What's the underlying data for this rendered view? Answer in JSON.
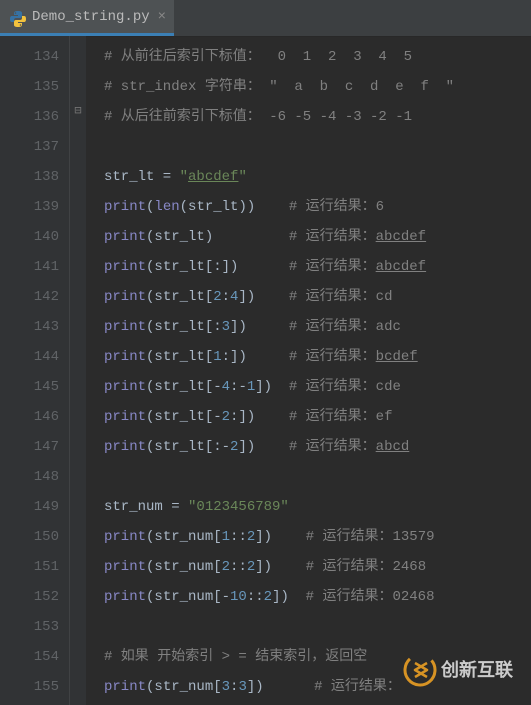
{
  "tab": {
    "filename": "Demo_string.py"
  },
  "lines": [
    {
      "n": "134",
      "fold": "",
      "t": [
        {
          "c": "tok-com",
          "x": "# 从前往后索引下标值：  0  1  2  3  4  5"
        }
      ]
    },
    {
      "n": "135",
      "fold": "",
      "t": [
        {
          "c": "tok-com",
          "x": "# str_index 字符串： ″  a  b  c  d  e  f  ″"
        }
      ]
    },
    {
      "n": "136",
      "fold": "⊟",
      "t": [
        {
          "c": "tok-com",
          "x": "# 从后往前索引下标值： -6 -5 -4 -3 -2 -1"
        }
      ]
    },
    {
      "n": "137",
      "fold": "",
      "t": []
    },
    {
      "n": "138",
      "fold": "",
      "t": [
        {
          "c": "tok-id",
          "x": "str_lt = "
        },
        {
          "c": "tok-str",
          "x": "″"
        },
        {
          "c": "tok-str ul",
          "x": "abcdef"
        },
        {
          "c": "tok-str",
          "x": "″"
        }
      ]
    },
    {
      "n": "139",
      "fold": "",
      "t": [
        {
          "c": "tok-bi",
          "x": "print"
        },
        {
          "c": "tok-id",
          "x": "("
        },
        {
          "c": "tok-bi",
          "x": "len"
        },
        {
          "c": "tok-id",
          "x": "(str_lt))    "
        },
        {
          "c": "tok-com",
          "x": "# 运行结果：6"
        }
      ]
    },
    {
      "n": "140",
      "fold": "",
      "t": [
        {
          "c": "tok-bi",
          "x": "print"
        },
        {
          "c": "tok-id",
          "x": "(str_lt)         "
        },
        {
          "c": "tok-com",
          "x": "# 运行结果："
        },
        {
          "c": "tok-com ul",
          "x": "abcdef"
        }
      ]
    },
    {
      "n": "141",
      "fold": "",
      "t": [
        {
          "c": "tok-bi",
          "x": "print"
        },
        {
          "c": "tok-id",
          "x": "(str_lt[:])      "
        },
        {
          "c": "tok-com",
          "x": "# 运行结果："
        },
        {
          "c": "tok-com ul",
          "x": "abcdef"
        }
      ]
    },
    {
      "n": "142",
      "fold": "",
      "t": [
        {
          "c": "tok-bi",
          "x": "print"
        },
        {
          "c": "tok-id",
          "x": "(str_lt["
        },
        {
          "c": "tok-num",
          "x": "2"
        },
        {
          "c": "tok-id",
          "x": ":"
        },
        {
          "c": "tok-num",
          "x": "4"
        },
        {
          "c": "tok-id",
          "x": "])    "
        },
        {
          "c": "tok-com",
          "x": "# 运行结果：cd"
        }
      ]
    },
    {
      "n": "143",
      "fold": "",
      "t": [
        {
          "c": "tok-bi",
          "x": "print"
        },
        {
          "c": "tok-id",
          "x": "(str_lt[:"
        },
        {
          "c": "tok-num",
          "x": "3"
        },
        {
          "c": "tok-id",
          "x": "])     "
        },
        {
          "c": "tok-com",
          "x": "# 运行结果：adc"
        }
      ]
    },
    {
      "n": "144",
      "fold": "",
      "t": [
        {
          "c": "tok-bi",
          "x": "print"
        },
        {
          "c": "tok-id",
          "x": "(str_lt["
        },
        {
          "c": "tok-num",
          "x": "1"
        },
        {
          "c": "tok-id",
          "x": ":])     "
        },
        {
          "c": "tok-com",
          "x": "# 运行结果："
        },
        {
          "c": "tok-com ul",
          "x": "bcdef"
        }
      ]
    },
    {
      "n": "145",
      "fold": "",
      "t": [
        {
          "c": "tok-bi",
          "x": "print"
        },
        {
          "c": "tok-id",
          "x": "(str_lt[-"
        },
        {
          "c": "tok-num",
          "x": "4"
        },
        {
          "c": "tok-id",
          "x": ":-"
        },
        {
          "c": "tok-num",
          "x": "1"
        },
        {
          "c": "tok-id",
          "x": "])  "
        },
        {
          "c": "tok-com",
          "x": "# 运行结果：cde"
        }
      ]
    },
    {
      "n": "146",
      "fold": "",
      "t": [
        {
          "c": "tok-bi",
          "x": "print"
        },
        {
          "c": "tok-id",
          "x": "(str_lt[-"
        },
        {
          "c": "tok-num",
          "x": "2"
        },
        {
          "c": "tok-id",
          "x": ":])    "
        },
        {
          "c": "tok-com",
          "x": "# 运行结果：ef"
        }
      ]
    },
    {
      "n": "147",
      "fold": "",
      "t": [
        {
          "c": "tok-bi",
          "x": "print"
        },
        {
          "c": "tok-id",
          "x": "(str_lt[:-"
        },
        {
          "c": "tok-num",
          "x": "2"
        },
        {
          "c": "tok-id",
          "x": "])    "
        },
        {
          "c": "tok-com",
          "x": "# 运行结果："
        },
        {
          "c": "tok-com ul",
          "x": "abcd"
        }
      ]
    },
    {
      "n": "148",
      "fold": "",
      "t": []
    },
    {
      "n": "149",
      "fold": "",
      "t": [
        {
          "c": "tok-id",
          "x": "str_num = "
        },
        {
          "c": "tok-str",
          "x": "″0123456789″"
        }
      ]
    },
    {
      "n": "150",
      "fold": "",
      "t": [
        {
          "c": "tok-bi",
          "x": "print"
        },
        {
          "c": "tok-id",
          "x": "(str_num["
        },
        {
          "c": "tok-num",
          "x": "1"
        },
        {
          "c": "tok-id",
          "x": "::"
        },
        {
          "c": "tok-num",
          "x": "2"
        },
        {
          "c": "tok-id",
          "x": "])    "
        },
        {
          "c": "tok-com",
          "x": "# 运行结果：13579"
        }
      ]
    },
    {
      "n": "151",
      "fold": "",
      "t": [
        {
          "c": "tok-bi",
          "x": "print"
        },
        {
          "c": "tok-id",
          "x": "(str_num["
        },
        {
          "c": "tok-num",
          "x": "2"
        },
        {
          "c": "tok-id",
          "x": "::"
        },
        {
          "c": "tok-num",
          "x": "2"
        },
        {
          "c": "tok-id",
          "x": "])    "
        },
        {
          "c": "tok-com",
          "x": "# 运行结果：2468"
        }
      ]
    },
    {
      "n": "152",
      "fold": "",
      "t": [
        {
          "c": "tok-bi",
          "x": "print"
        },
        {
          "c": "tok-id",
          "x": "(str_num[-"
        },
        {
          "c": "tok-num",
          "x": "10"
        },
        {
          "c": "tok-id",
          "x": "::"
        },
        {
          "c": "tok-num",
          "x": "2"
        },
        {
          "c": "tok-id",
          "x": "])  "
        },
        {
          "c": "tok-com",
          "x": "# 运行结果：02468"
        }
      ]
    },
    {
      "n": "153",
      "fold": "",
      "t": []
    },
    {
      "n": "154",
      "fold": "",
      "t": [
        {
          "c": "tok-com",
          "x": "# 如果 开始索引 > = 结束索引，返回空"
        }
      ]
    },
    {
      "n": "155",
      "fold": "",
      "t": [
        {
          "c": "tok-bi",
          "x": "print"
        },
        {
          "c": "tok-id",
          "x": "(str_num["
        },
        {
          "c": "tok-num",
          "x": "3"
        },
        {
          "c": "tok-id",
          "x": ":"
        },
        {
          "c": "tok-num",
          "x": "3"
        },
        {
          "c": "tok-id",
          "x": "])      "
        },
        {
          "c": "tok-com",
          "x": "# 运行结果："
        }
      ]
    }
  ],
  "watermark": {
    "text": "创新互联"
  }
}
